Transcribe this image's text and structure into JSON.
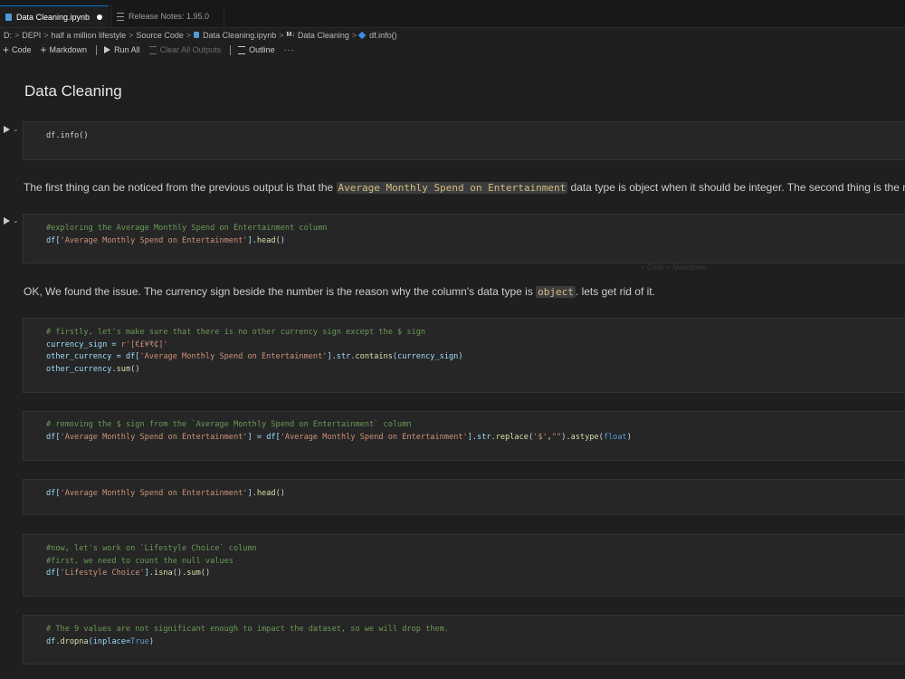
{
  "tabs": [
    {
      "label": "Data Cleaning.ipynb",
      "active": true,
      "dirty": true,
      "icon": "notebook-icon"
    },
    {
      "label": "Release Notes: 1.95.0",
      "active": false,
      "icon": "preview-icon"
    }
  ],
  "breadcrumb": {
    "drive": "D:",
    "folder1": "DEPI",
    "folder2": "half a million lifestyle",
    "folder3": "Source Code",
    "file": "Data Cleaning.ipynb",
    "md_badge": "M↓",
    "section": "Data Cleaning",
    "symbol": "df.info()"
  },
  "toolbar": {
    "code": "Code",
    "markdown": "Markdown",
    "run_all": "Run All",
    "clear_all": "Clear All Outputs",
    "outline": "Outline",
    "more": "···"
  },
  "heading": "Data Cleaning",
  "cells": {
    "c1": {
      "code": "df.info()"
    },
    "md1": {
      "before": "The first thing can be noticed from the previous output is that the ",
      "code": "Average Monthly Spend on Entertainment",
      "after": " data type is object when it should be integer. The second thing is the m"
    },
    "c2": {
      "comment": "#exploring the Average Monthly Spend on Entertainment column",
      "l2_a": "df[",
      "l2_str": "'Average Monthly Spend on Entertainment'",
      "l2_b": "].",
      "l2_fn": "head",
      "l2_c": "()"
    },
    "ghost": "+ Code  + Markdown",
    "md2": {
      "before": "OK, We found the issue. The currency sign beside the number is the reason why the column's data type is ",
      "code": "object",
      "after": ". lets get rid of it."
    },
    "c3": {
      "comment": "# firstly, let's make sure that there is no other currency sign except the $ sign",
      "l2_a": "currency_sign = ",
      "l2_str": "r'[€£¥₹₵]'",
      "l3_a": "other_currency = df[",
      "l3_str": "'Average Monthly Spend on Entertainment'",
      "l3_b": "].str.",
      "l3_fn": "contains",
      "l3_c": "(currency_sign)",
      "l4_a": "other_currency.",
      "l4_fn": "sum",
      "l4_b": "()"
    },
    "c4": {
      "comment": "# removing the $ sign from the `Average Monthly Spend on Entertainment` column",
      "a": "df[",
      "s1": "'Average Monthly Spend on Entertainment'",
      "b": "] = df[",
      "s2": "'Average Monthly Spend on Entertainment'",
      "c": "].str.",
      "fn1": "replace",
      "d": "(",
      "s3": "'$'",
      "e": ",",
      "s4": "\"\"",
      "f": ").",
      "fn2": "astype",
      "g": "(",
      "kw": "float",
      "h": ")"
    },
    "c5": {
      "a": "df[",
      "str": "'Average Monthly Spend on Entertainment'",
      "b": "].",
      "fn": "head",
      "c": "()"
    },
    "c6": {
      "comment1": "#now, let's work on `Lifestyle Choice` column",
      "comment2": "#first, we need to count the null values",
      "a": "df[",
      "str": "'Lifestyle Choice'",
      "b": "].",
      "fn1": "isna",
      "c": "().",
      "fn2": "sum",
      "d": "()"
    },
    "c7": {
      "comment": "# The 9 values are not significant enough to impact the dataset, so we will drop them.",
      "a": "df.",
      "fn": "dropna",
      "b": "(inplace=",
      "kw": "True",
      "c": ")"
    }
  },
  "colors": {
    "accent": "#0078d4",
    "comment": "#6a9955",
    "string": "#ce9178",
    "function": "#dcdcaa",
    "keyword": "#569cd6",
    "variable": "#9cdcfe"
  }
}
